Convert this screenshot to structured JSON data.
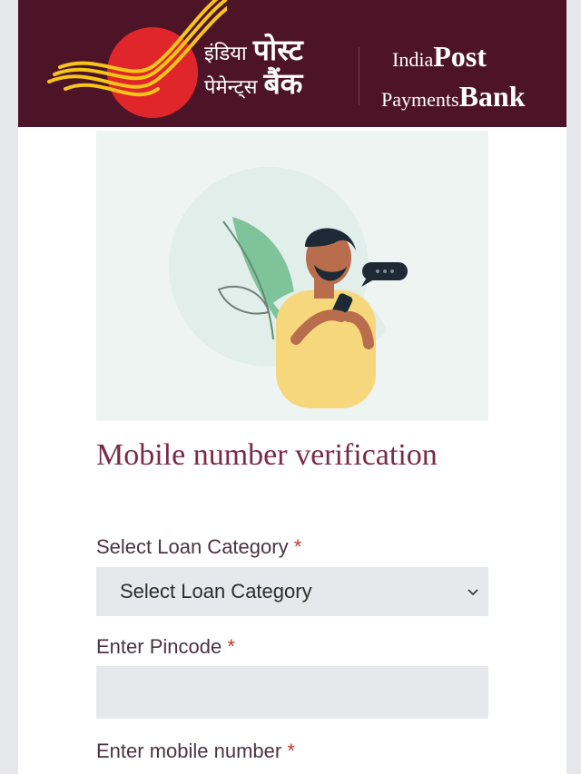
{
  "header": {
    "hindi_line1_small": "इंडिया",
    "hindi_line1_big": "पोस्ट",
    "hindi_line2_small": "पेमेन्ट्स",
    "hindi_line2_big": "बैंक",
    "eng_line1_small": "India",
    "eng_line1_big": "Post",
    "eng_line2_small": "Payments",
    "eng_line2_big": "Bank",
    "colors": {
      "bar": "#4d1428",
      "logo_sun": "#e0262b",
      "logo_stripes": "#f5c518"
    }
  },
  "illustration": {
    "name": "person-using-phone-illustration"
  },
  "form": {
    "title": "Mobile number verification",
    "loan_category": {
      "label": "Select Loan Category",
      "required_mark": "*",
      "selected": "Select Loan Category"
    },
    "pincode": {
      "label": "Enter Pincode",
      "required_mark": "*",
      "value": ""
    },
    "mobile": {
      "label": "Enter mobile number",
      "required_mark": "*"
    }
  }
}
